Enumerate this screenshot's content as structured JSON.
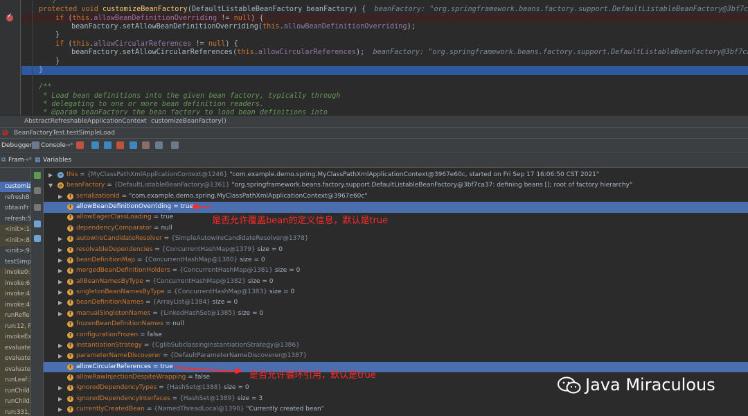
{
  "editor": {
    "lines": [
      {
        "text": "*/"
      },
      {
        "kw1": "protected void ",
        "fn": "customizeBeanFactory",
        "args": "(DefaultListableBeanFactory beanFactory) {",
        "hint": "beanFactory: \"org.springframework.beans.factory.support.DefaultListableBeanFactory@3bf7ca37: def"
      },
      {
        "kw": "if ",
        "a": "(",
        "kw2": "this",
        "b": ".",
        "fld": "allowBeanDefinitionOverriding",
        "c": " != ",
        "kw3": "null",
        "d": ") {"
      },
      {
        "pre": "beanFactory.setAllowBeanDefinitionOverriding(",
        "kw": "this",
        "b": ".",
        "fld": "allowBeanDefinitionOverriding",
        "c": ");"
      },
      {
        "text": "}"
      },
      {
        "kw": "if ",
        "a": "(",
        "kw2": "this",
        "b": ".",
        "fld": "allowCircularReferences",
        "c": " != ",
        "kw3": "null",
        "d": ") {"
      },
      {
        "pre": "beanFactory.setAllowCircularReferences(",
        "kw": "this",
        "b": ".",
        "fld": "allowCircularReferences",
        "c": ");",
        "hint": "beanFactory: \"org.springframework.beans.factory.support.DefaultListableBeanFactory@3bf7ca37: def"
      },
      {
        "text": "}"
      },
      {
        "text": "}"
      },
      {
        "text": ""
      },
      {
        "text": "/**"
      },
      {
        "text": " * Load bean definitions into the given bean factory, typically through"
      },
      {
        "text": " * delegating to one or more bean definition readers."
      },
      {
        "text": " * @param beanFactory the bean factory to load bean definitions into"
      }
    ]
  },
  "breadcrumb": [
    "AbstractRefreshableApplicationContext",
    "customizeBeanFactory()"
  ],
  "debug_session": "BeanFactoryTest.testSimpleLoad",
  "toolbar": {
    "debugger_tab": "Debugger",
    "console_tab": "Console"
  },
  "panels": {
    "frames": "Fram",
    "variables": "Variables"
  },
  "frames": [
    "customiz",
    "refreshB",
    "obtainFr",
    "refresh:5",
    "<init>:14",
    "<init>:85",
    "<init>:9,",
    "testSimp",
    "invoke0:",
    "invoke:6",
    "invoke:4",
    "invoke:49",
    "runRefle",
    "run:12, R",
    "invokeEx",
    "evaluate",
    "evaluate",
    "evaluate",
    "runLeaf:3",
    "runChild",
    "runChild",
    "run:331,"
  ],
  "variables": [
    {
      "indent": 0,
      "arrow": "▶",
      "name": "this",
      "type": "{MyClassPathXmlApplicationContext@1246}",
      "value": "\"com.example.demo.spring.MyClassPathXmlApplicationContext@3967e60c, started on Fri Sep 17 16:06:50 CST 2021\"",
      "icon": "eq"
    },
    {
      "indent": 0,
      "arrow": "▼",
      "name": "beanFactory",
      "type": "{DefaultListableBeanFactory@1361}",
      "value": "\"org.springframework.beans.factory.support.DefaultListableBeanFactory@3bf7ca37: defining beans []; root of factory hierarchy\"",
      "icon": "p"
    },
    {
      "indent": 1,
      "arrow": "▶",
      "name": "serializationId",
      "type": "",
      "value": "\"com.example.demo.spring.MyClassPathXmlApplicationContext@3967e60c\"",
      "icon": "f"
    },
    {
      "indent": 1,
      "arrow": "",
      "name": "allowBeanDefinitionOverriding",
      "type": "",
      "value": "true",
      "icon": "f",
      "selected": true
    },
    {
      "indent": 1,
      "arrow": "",
      "name": "allowEagerClassLoading",
      "type": "",
      "value": "true",
      "icon": "f"
    },
    {
      "indent": 1,
      "arrow": "",
      "name": "dependencyComparator",
      "type": "",
      "value": "null",
      "icon": "f"
    },
    {
      "indent": 1,
      "arrow": "▶",
      "name": "autowireCandidateResolver",
      "type": "{SimpleAutowireCandidateResolver@1378}",
      "value": "",
      "icon": "f"
    },
    {
      "indent": 1,
      "arrow": "▶",
      "name": "resolvableDependencies",
      "type": "{ConcurrentHashMap@1379}",
      "value": "size = 0",
      "icon": "f"
    },
    {
      "indent": 1,
      "arrow": "▶",
      "name": "beanDefinitionMap",
      "type": "{ConcurrentHashMap@1380}",
      "value": "size = 0",
      "icon": "f"
    },
    {
      "indent": 1,
      "arrow": "▶",
      "name": "mergedBeanDefinitionHolders",
      "type": "{ConcurrentHashMap@1381}",
      "value": "size = 0",
      "icon": "f"
    },
    {
      "indent": 1,
      "arrow": "▶",
      "name": "allBeanNamesByType",
      "type": "{ConcurrentHashMap@1382}",
      "value": "size = 0",
      "icon": "f"
    },
    {
      "indent": 1,
      "arrow": "▶",
      "name": "singletonBeanNamesByType",
      "type": "{ConcurrentHashMap@1383}",
      "value": "size = 0",
      "icon": "f"
    },
    {
      "indent": 1,
      "arrow": "▶",
      "name": "beanDefinitionNames",
      "type": "{ArrayList@1384}",
      "value": "size = 0",
      "icon": "f"
    },
    {
      "indent": 1,
      "arrow": "▶",
      "name": "manualSingletonNames",
      "type": "{LinkedHashSet@1385}",
      "value": "size = 0",
      "icon": "f"
    },
    {
      "indent": 1,
      "arrow": "",
      "name": "frozenBeanDefinitionNames",
      "type": "",
      "value": "null",
      "icon": "f"
    },
    {
      "indent": 1,
      "arrow": "",
      "name": "configurationFrozen",
      "type": "",
      "value": "false",
      "icon": "f"
    },
    {
      "indent": 1,
      "arrow": "▶",
      "name": "instantiationStrategy",
      "type": "{CglibSubclassingInstantiationStrategy@1386}",
      "value": "",
      "icon": "f"
    },
    {
      "indent": 1,
      "arrow": "▶",
      "name": "parameterNameDiscoverer",
      "type": "{DefaultParameterNameDiscoverer@1387}",
      "value": "",
      "icon": "f"
    },
    {
      "indent": 1,
      "arrow": "",
      "name": "allowCircularReferences",
      "type": "",
      "value": "true",
      "icon": "f",
      "selected": true
    },
    {
      "indent": 1,
      "arrow": "",
      "name": "allowRawInjectionDespiteWrapping",
      "type": "",
      "value": "false",
      "icon": "f"
    },
    {
      "indent": 1,
      "arrow": "▶",
      "name": "ignoredDependencyTypes",
      "type": "{HashSet@1388}",
      "value": "size = 0",
      "icon": "f"
    },
    {
      "indent": 1,
      "arrow": "▶",
      "name": "ignoredDependencyInterfaces",
      "type": "{HashSet@1389}",
      "value": "size = 3",
      "icon": "f"
    },
    {
      "indent": 1,
      "arrow": "▶",
      "name": "currentlyCreatedBean",
      "type": "{NamedThreadLocal@1390}",
      "value": "\"Currently created bean\"",
      "icon": "f"
    }
  ],
  "annotations": {
    "note1": "是否允许覆盖bean的定义信息，默认是true",
    "note2": "是否允许循环引用，默认是true"
  },
  "watermark": "Java Miraculous",
  "colors": {
    "annotation": "#ff2a2a",
    "selection": "#4b6eaf",
    "current_line": "#2d5a9e"
  }
}
